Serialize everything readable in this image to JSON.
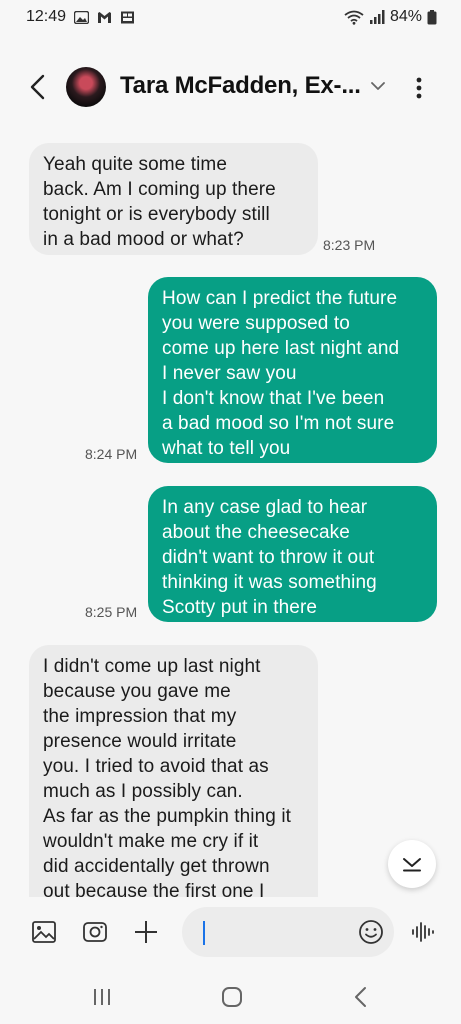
{
  "status_bar": {
    "time": "12:49",
    "battery": "84%",
    "icons": [
      "gallery-icon",
      "gmail-icon",
      "app-icon",
      "wifi-icon",
      "signal-icon",
      "battery-icon"
    ]
  },
  "header": {
    "contact_name": "Tara McFadden, Ex-...",
    "icons": [
      "back-arrow-icon",
      "chevron-down-icon",
      "more-vert-icon"
    ]
  },
  "messages": [
    {
      "direction": "incoming",
      "text": "Yeah quite some time\nback. Am I coming up there\ntonight or is everybody still\nin a bad mood or what?",
      "time": "8:23 PM"
    },
    {
      "direction": "outgoing",
      "text": "How can I predict the future\nyou were supposed to\ncome up here last night and\nI never saw you\nI don't know that I've been\na bad mood so I'm not sure\nwhat to tell you",
      "time": "8:24 PM"
    },
    {
      "direction": "outgoing",
      "text": "In any case glad to hear\nabout the cheesecake\ndidn't want to throw it out\nthinking it was something\nScotty put in there",
      "time": "8:25 PM"
    },
    {
      "direction": "incoming",
      "text": "I didn't come up last night\nbecause you gave me\nthe impression that my\npresence would irritate\nyou. I tried to avoid that as\nmuch as I possibly can.\nAs far as the pumpkin thing it\nwouldn't make me cry if it\ndid accidentally get thrown\nout because the first one I\ndid eat was disa...",
      "time": ""
    }
  ],
  "composer": {
    "placeholder": "",
    "value": ""
  },
  "colors": {
    "outgoing_bubble": "#079f85",
    "incoming_bubble": "#ebebeb",
    "background": "#f7f7f7"
  }
}
